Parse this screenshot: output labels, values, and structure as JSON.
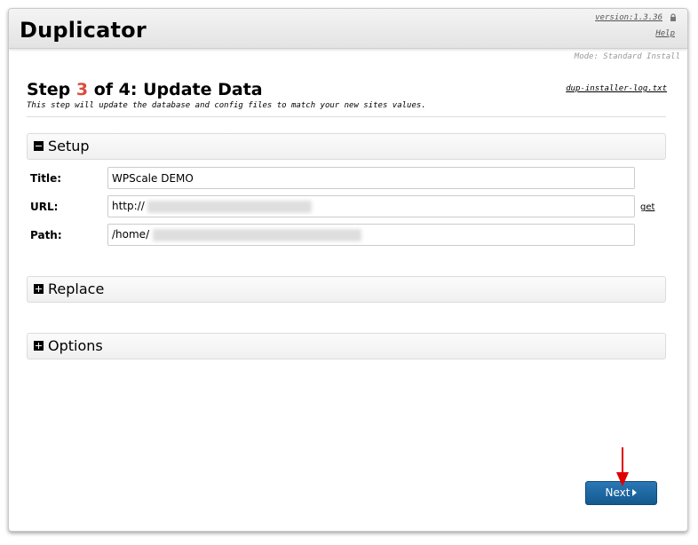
{
  "header": {
    "app_title": "Duplicator",
    "version": "version:1.3.36",
    "help": "Help"
  },
  "mode": "Mode: Standard Install",
  "step": {
    "prefix": "Step ",
    "number": "3",
    "suffix": " of 4: Update Data",
    "description": "This step will update the database and config files to match your new sites values.",
    "log_link": "dup-installer-log.txt"
  },
  "sections": {
    "setup": {
      "label": "Setup",
      "state": "expanded",
      "icon": "minus-square-icon"
    },
    "replace": {
      "label": "Replace",
      "state": "collapsed",
      "icon": "plus-square-icon"
    },
    "options": {
      "label": "Options",
      "state": "collapsed",
      "icon": "plus-square-icon"
    }
  },
  "fields": {
    "title": {
      "label": "Title:",
      "value": "WPScale DEMO"
    },
    "url": {
      "label": "URL:",
      "value": "http://",
      "get_link": "get"
    },
    "path": {
      "label": "Path:",
      "value": "/home/"
    }
  },
  "buttons": {
    "next": "Next"
  },
  "colors": {
    "step_number": "#db4b39",
    "button": "#1f6aa5",
    "annotation_arrow": "#e00000"
  }
}
